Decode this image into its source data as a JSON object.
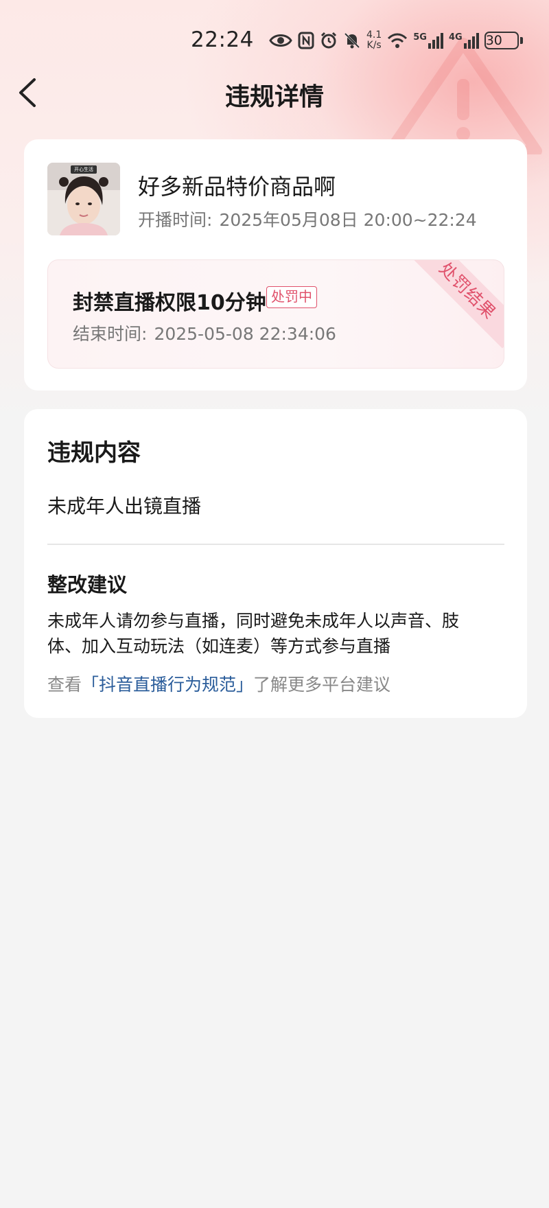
{
  "status_bar": {
    "time": "22:24",
    "net_speed_value": "4.1",
    "net_speed_unit": "K/s",
    "signal_1": "5G",
    "signal_2": "4G",
    "battery": "30"
  },
  "nav": {
    "back_icon": "chevron-left-icon",
    "title": "违规详情"
  },
  "stream": {
    "title": "好多新品特价商品啊",
    "start_label": "开播时间:",
    "start_time": "2025年05月08日 20:00~22:24",
    "avatar_caption": "开心生活"
  },
  "penalty": {
    "title": "封禁直播权限10分钟",
    "status": "处罚中",
    "end_label": "结束时间:",
    "end_time": "2025-05-08 22:34:06",
    "ribbon": "处罚结果"
  },
  "violation": {
    "section_title": "违规内容",
    "content": "未成年人出镜直播",
    "suggestion_title": "整改建议",
    "suggestion": "未成年人请勿参与直播，同时避免未成年人以声音、肢体、加入互动玩法（如连麦）等方式参与直播",
    "guide_prefix": "查看",
    "guide_link": "「抖音直播行为规范」",
    "guide_suffix": "了解更多平台建议"
  },
  "colors": {
    "accent_red": "#e0516b",
    "link_blue": "#2a5c9a",
    "background": "#f4f4f4"
  }
}
